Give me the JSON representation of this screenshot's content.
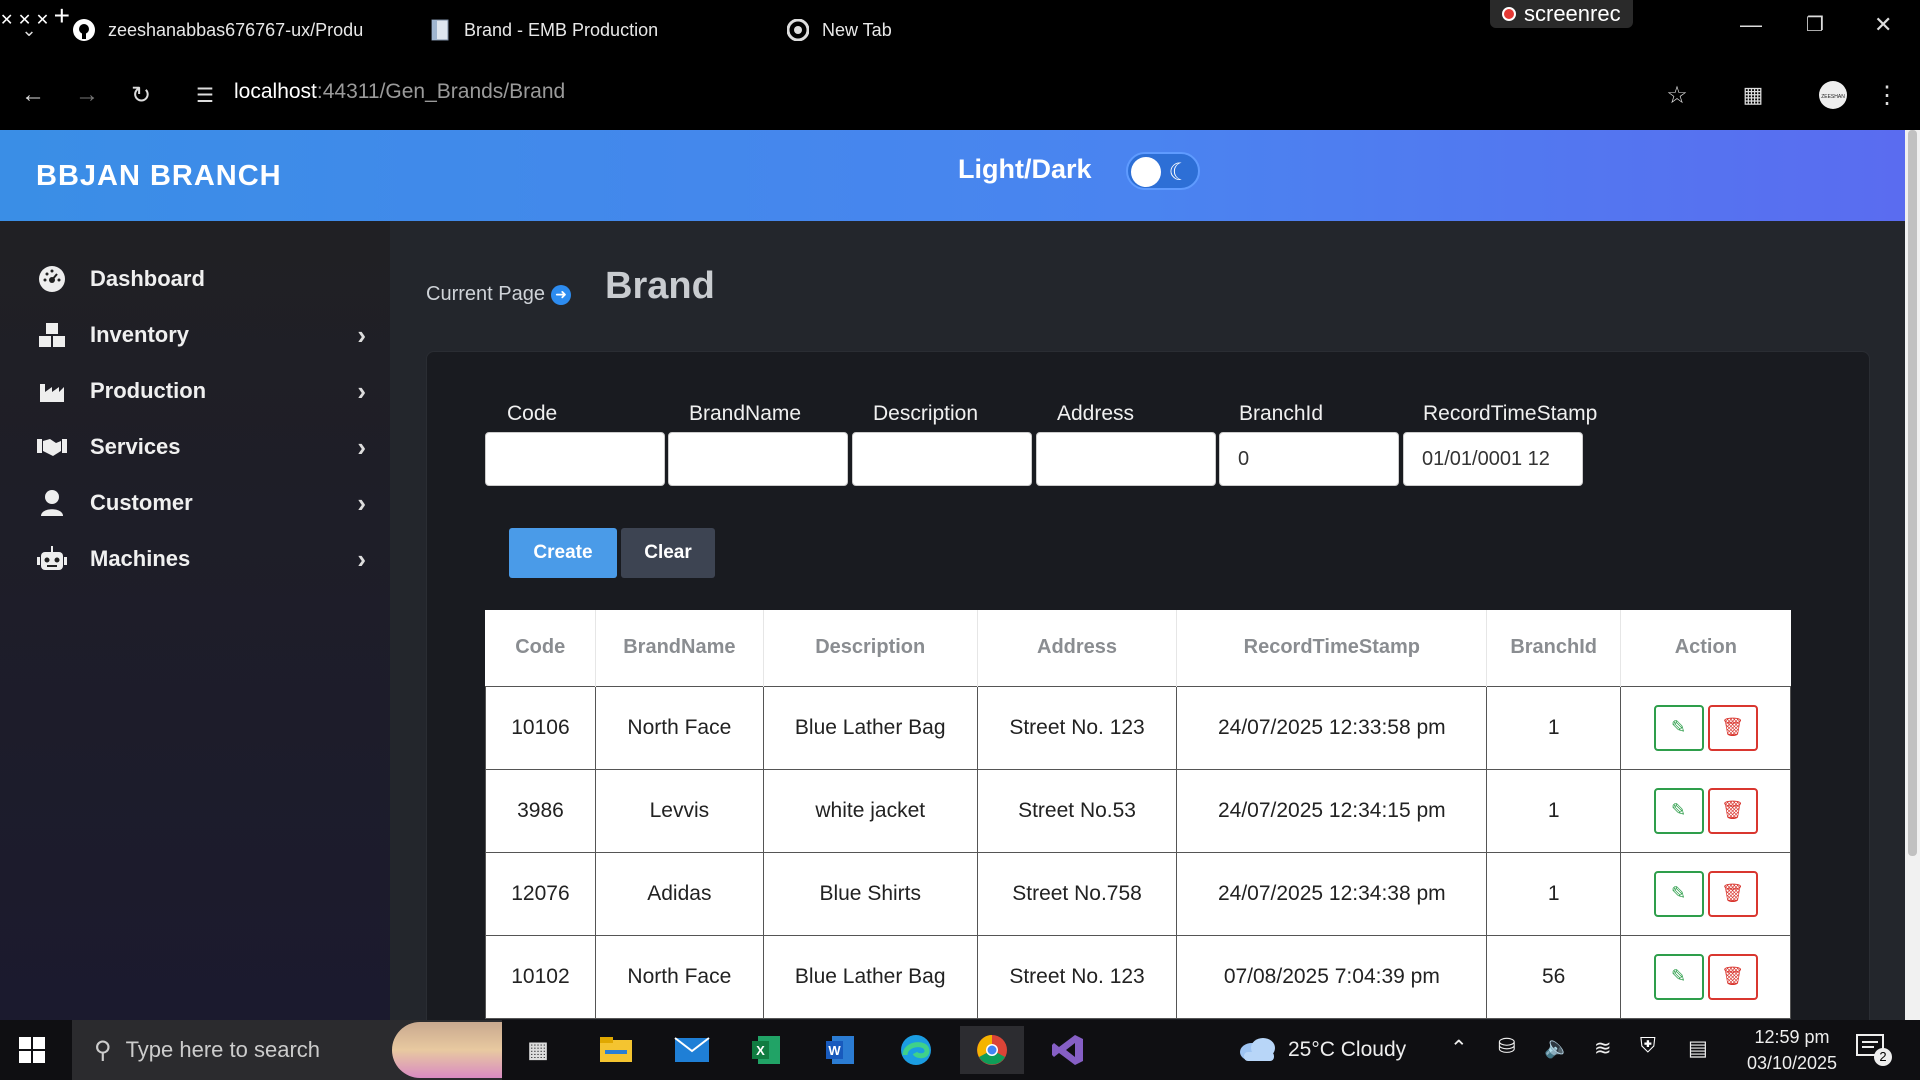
{
  "browser": {
    "tabs": [
      {
        "title": "zeeshanabbas676767-ux/Produ",
        "icon": "github-icon"
      },
      {
        "title": "Brand - EMB Production",
        "icon": "document-icon"
      },
      {
        "title": "New Tab",
        "icon": "chrome-icon"
      }
    ],
    "url_host": "localhost",
    "url_rest": ":44311/Gen_Brands/Brand",
    "recording_label": "screenrec"
  },
  "header": {
    "brand": "BBJAN BRANCH",
    "theme_label": "Light/Dark"
  },
  "sidebar": {
    "items": [
      {
        "label": "Dashboard",
        "icon": "gauge-icon",
        "has_chevron": false
      },
      {
        "label": "Inventory",
        "icon": "boxes-icon",
        "has_chevron": true
      },
      {
        "label": "Production",
        "icon": "factory-icon",
        "has_chevron": true
      },
      {
        "label": "Services",
        "icon": "handshake-icon",
        "has_chevron": true
      },
      {
        "label": "Customer",
        "icon": "user-icon",
        "has_chevron": true
      },
      {
        "label": "Machines",
        "icon": "robot-icon",
        "has_chevron": true
      }
    ]
  },
  "main": {
    "breadcrumb": "Current Page",
    "title": "Brand",
    "form": {
      "fields": [
        {
          "label": "Code",
          "value": ""
        },
        {
          "label": "BrandName",
          "value": ""
        },
        {
          "label": "Description",
          "value": ""
        },
        {
          "label": "Address",
          "value": ""
        },
        {
          "label": "BranchId",
          "value": "0"
        },
        {
          "label": "RecordTimeStamp",
          "value": "01/01/0001 12"
        }
      ],
      "create_label": "Create",
      "clear_label": "Clear"
    },
    "table": {
      "headers": [
        "Code",
        "BrandName",
        "Description",
        "Address",
        "RecordTimeStamp",
        "BranchId",
        "Action"
      ],
      "rows": [
        [
          "10106",
          "North Face",
          "Blue Lather Bag",
          "Street No. 123",
          "24/07/2025 12:33:58 pm",
          "1"
        ],
        [
          "3986",
          "Levvis",
          "white jacket",
          "Street No.53",
          "24/07/2025 12:34:15 pm",
          "1"
        ],
        [
          "12076",
          "Adidas",
          "Blue Shirts",
          "Street No.758",
          "24/07/2025 12:34:38 pm",
          "1"
        ],
        [
          "10102",
          "North Face",
          "Blue Lather Bag",
          "Street No. 123",
          "07/08/2025 7:04:39 pm",
          "56"
        ]
      ]
    }
  },
  "taskbar": {
    "search_placeholder": "Type here to search",
    "weather": "25°C  Cloudy",
    "time": "12:59 pm",
    "date": "03/10/2025",
    "notification_count": "2"
  },
  "colors": {
    "header_gradient_start": "#3a8ee6",
    "header_gradient_end": "#5a6cf0",
    "create_button": "#4a9be8",
    "edit_action": "#2e9e4b",
    "delete_action": "#d9362f"
  }
}
